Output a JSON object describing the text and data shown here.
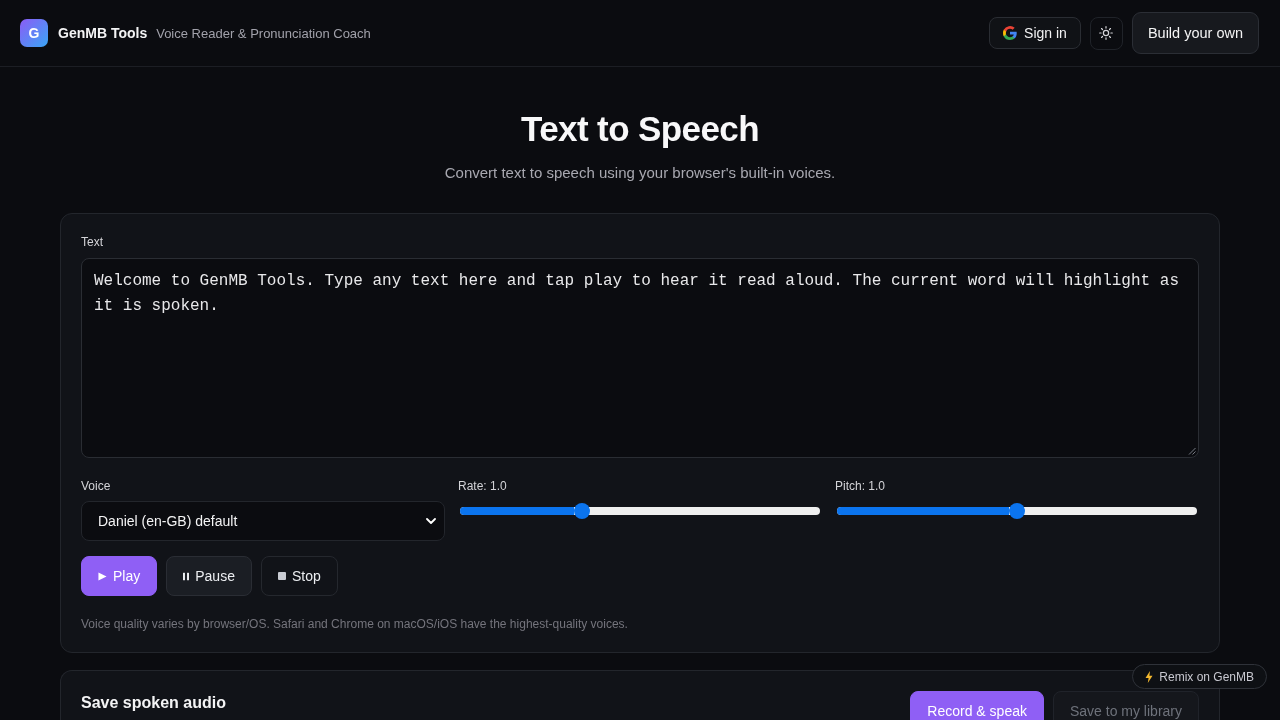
{
  "header": {
    "logo": "G",
    "brand": "GenMB Tools",
    "tagline": "Voice Reader & Pronunciation Coach",
    "sign_in_button": "Sign in",
    "build_button": "Build your own"
  },
  "hero": {
    "title": "Text to Speech",
    "subtitle": "Convert text to speech using your browser's built-in voices."
  },
  "speech_card": {
    "text_label": "Text",
    "text_value": "Welcome to GenMB Tools. Type any text here and tap play to hear it read aloud. The current word will highlight as it is spoken.",
    "voice_label": "Voice",
    "voice_value": "Daniel (en-GB) default",
    "sliders": [
      {
        "label": "Rate: 1.0",
        "level": 0.34
      },
      {
        "label": "Pitch: 1.0",
        "level": 0.5
      }
    ],
    "buttons": [
      {
        "kind": "primary",
        "label": "Play"
      },
      {
        "kind": "secondary",
        "label": "Pause"
      },
      {
        "kind": "outline",
        "label": "Stop"
      }
    ],
    "note": "Voice quality varies by browser/OS. Safari and Chrome on macOS/iOS have the highest-quality voices."
  },
  "save_card": {
    "title": "Save spoken audio",
    "buttons": [
      {
        "kind": "primary",
        "label": "Record & speak",
        "disabled": false
      },
      {
        "kind": "secondary",
        "label": "Save to my library",
        "disabled": true
      }
    ]
  },
  "remix_button": "Remix on GenMB"
}
